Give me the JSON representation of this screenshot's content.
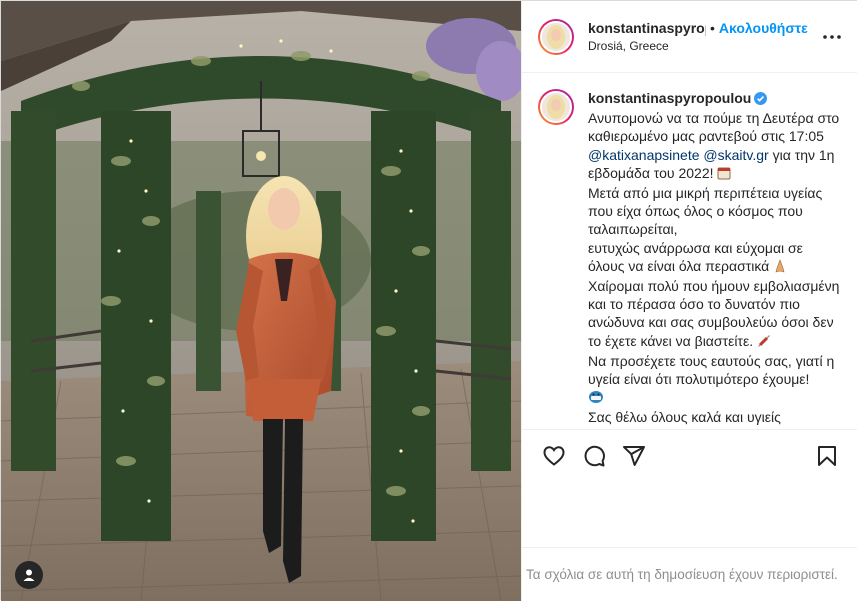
{
  "post": {
    "username": "konstantinaspyropoulou",
    "username_truncated": "konstantinaspyrop",
    "separator": "•",
    "follow_label": "Ακολουθήστε",
    "location": "Drosiá, Greece",
    "more_icon": "more-horizontal-icon"
  },
  "caption": {
    "username": "konstantinaspyropoulou",
    "text_1": "Ανυπομονώ να τα πούμε τη Δευτέρα στο καθιερωμένο μας ραντεβού στις 17:05",
    "mention_1": "@katixanapsinete",
    "mention_2": "@skaitv.gr",
    "text_2": "για την 1η εβδομάδα του 2022!",
    "line_3": "Μετά από μια μικρή περιπέτεια υγείας που είχα όπως όλος ο κόσμος που ταλαιπωρείται,",
    "line_4": "ευτυχώς ανάρρωσα και εύχομαι σε όλους να είναι όλα περαστικά",
    "line_5": "Χαίρομαι πολύ που ήμουν εμβολιασμένη και το πέρασα όσο το δυνατόν πιο ανώδυνα και σας συμβουλεύω όσοι δεν το έχετε κάνει να βιαστείτε.",
    "line_6": "Να προσέχετε τους εαυτούς σας, γιατί η υγεία είναι ότι πολυτιμότερο έχουμε!",
    "line_7": "Σας θέλω όλους καλά και υγιείς"
  },
  "actions": {
    "like_icon": "heart-icon",
    "comment_icon": "comment-icon",
    "share_icon": "paper-plane-icon",
    "save_icon": "bookmark-icon"
  },
  "comments_notice": "Τα σχόλια σε αυτή τη δημοσίευση έχουν περιοριστεί.",
  "colors": {
    "link_blue": "#0095f6",
    "mention_blue": "#00376b",
    "muted_gray": "#8e8e8e",
    "verified_blue": "#3897f0"
  }
}
